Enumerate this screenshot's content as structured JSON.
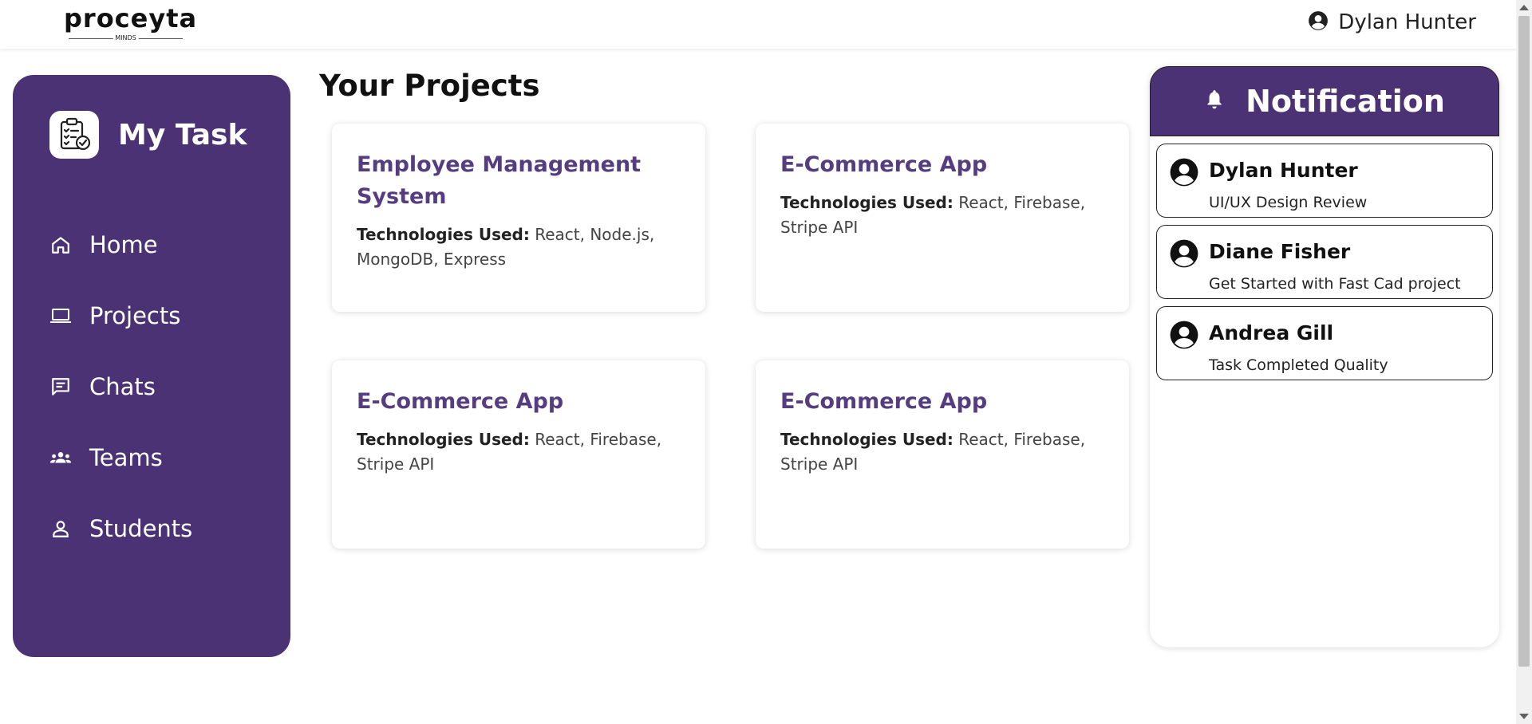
{
  "header": {
    "logo_word": "proceyta",
    "logo_sub": "MINDS",
    "user_name": "Dylan Hunter"
  },
  "sidebar": {
    "brand_title": "My Task",
    "items": [
      {
        "label": "Home",
        "icon": "home-icon"
      },
      {
        "label": "Projects",
        "icon": "laptop-icon"
      },
      {
        "label": "Chats",
        "icon": "chat-icon"
      },
      {
        "label": "Teams",
        "icon": "group-icon"
      },
      {
        "label": "Students",
        "icon": "person-icon"
      }
    ]
  },
  "main": {
    "title": "Your Projects",
    "tech_label": "Technologies Used:",
    "projects": [
      {
        "title": "Employee Management System",
        "technologies": "React, Node.js, MongoDB, Express"
      },
      {
        "title": "E-Commerce App",
        "technologies": "React, Firebase, Stripe API"
      },
      {
        "title": "E-Commerce App",
        "technologies": "React, Firebase, Stripe API"
      },
      {
        "title": "E-Commerce App",
        "technologies": "React, Firebase, Stripe API"
      }
    ]
  },
  "notifications": {
    "title": "Notification",
    "items": [
      {
        "name": "Dylan Hunter",
        "text": "UI/UX Design Review"
      },
      {
        "name": "Diane Fisher",
        "text": "Get Started with Fast Cad project"
      },
      {
        "name": "Andrea Gill",
        "text": "Task Completed Quality"
      }
    ]
  },
  "colors": {
    "sidebar_bg": "#4b3274",
    "accent_text": "#563d80",
    "card_bg": "#ffffff"
  }
}
